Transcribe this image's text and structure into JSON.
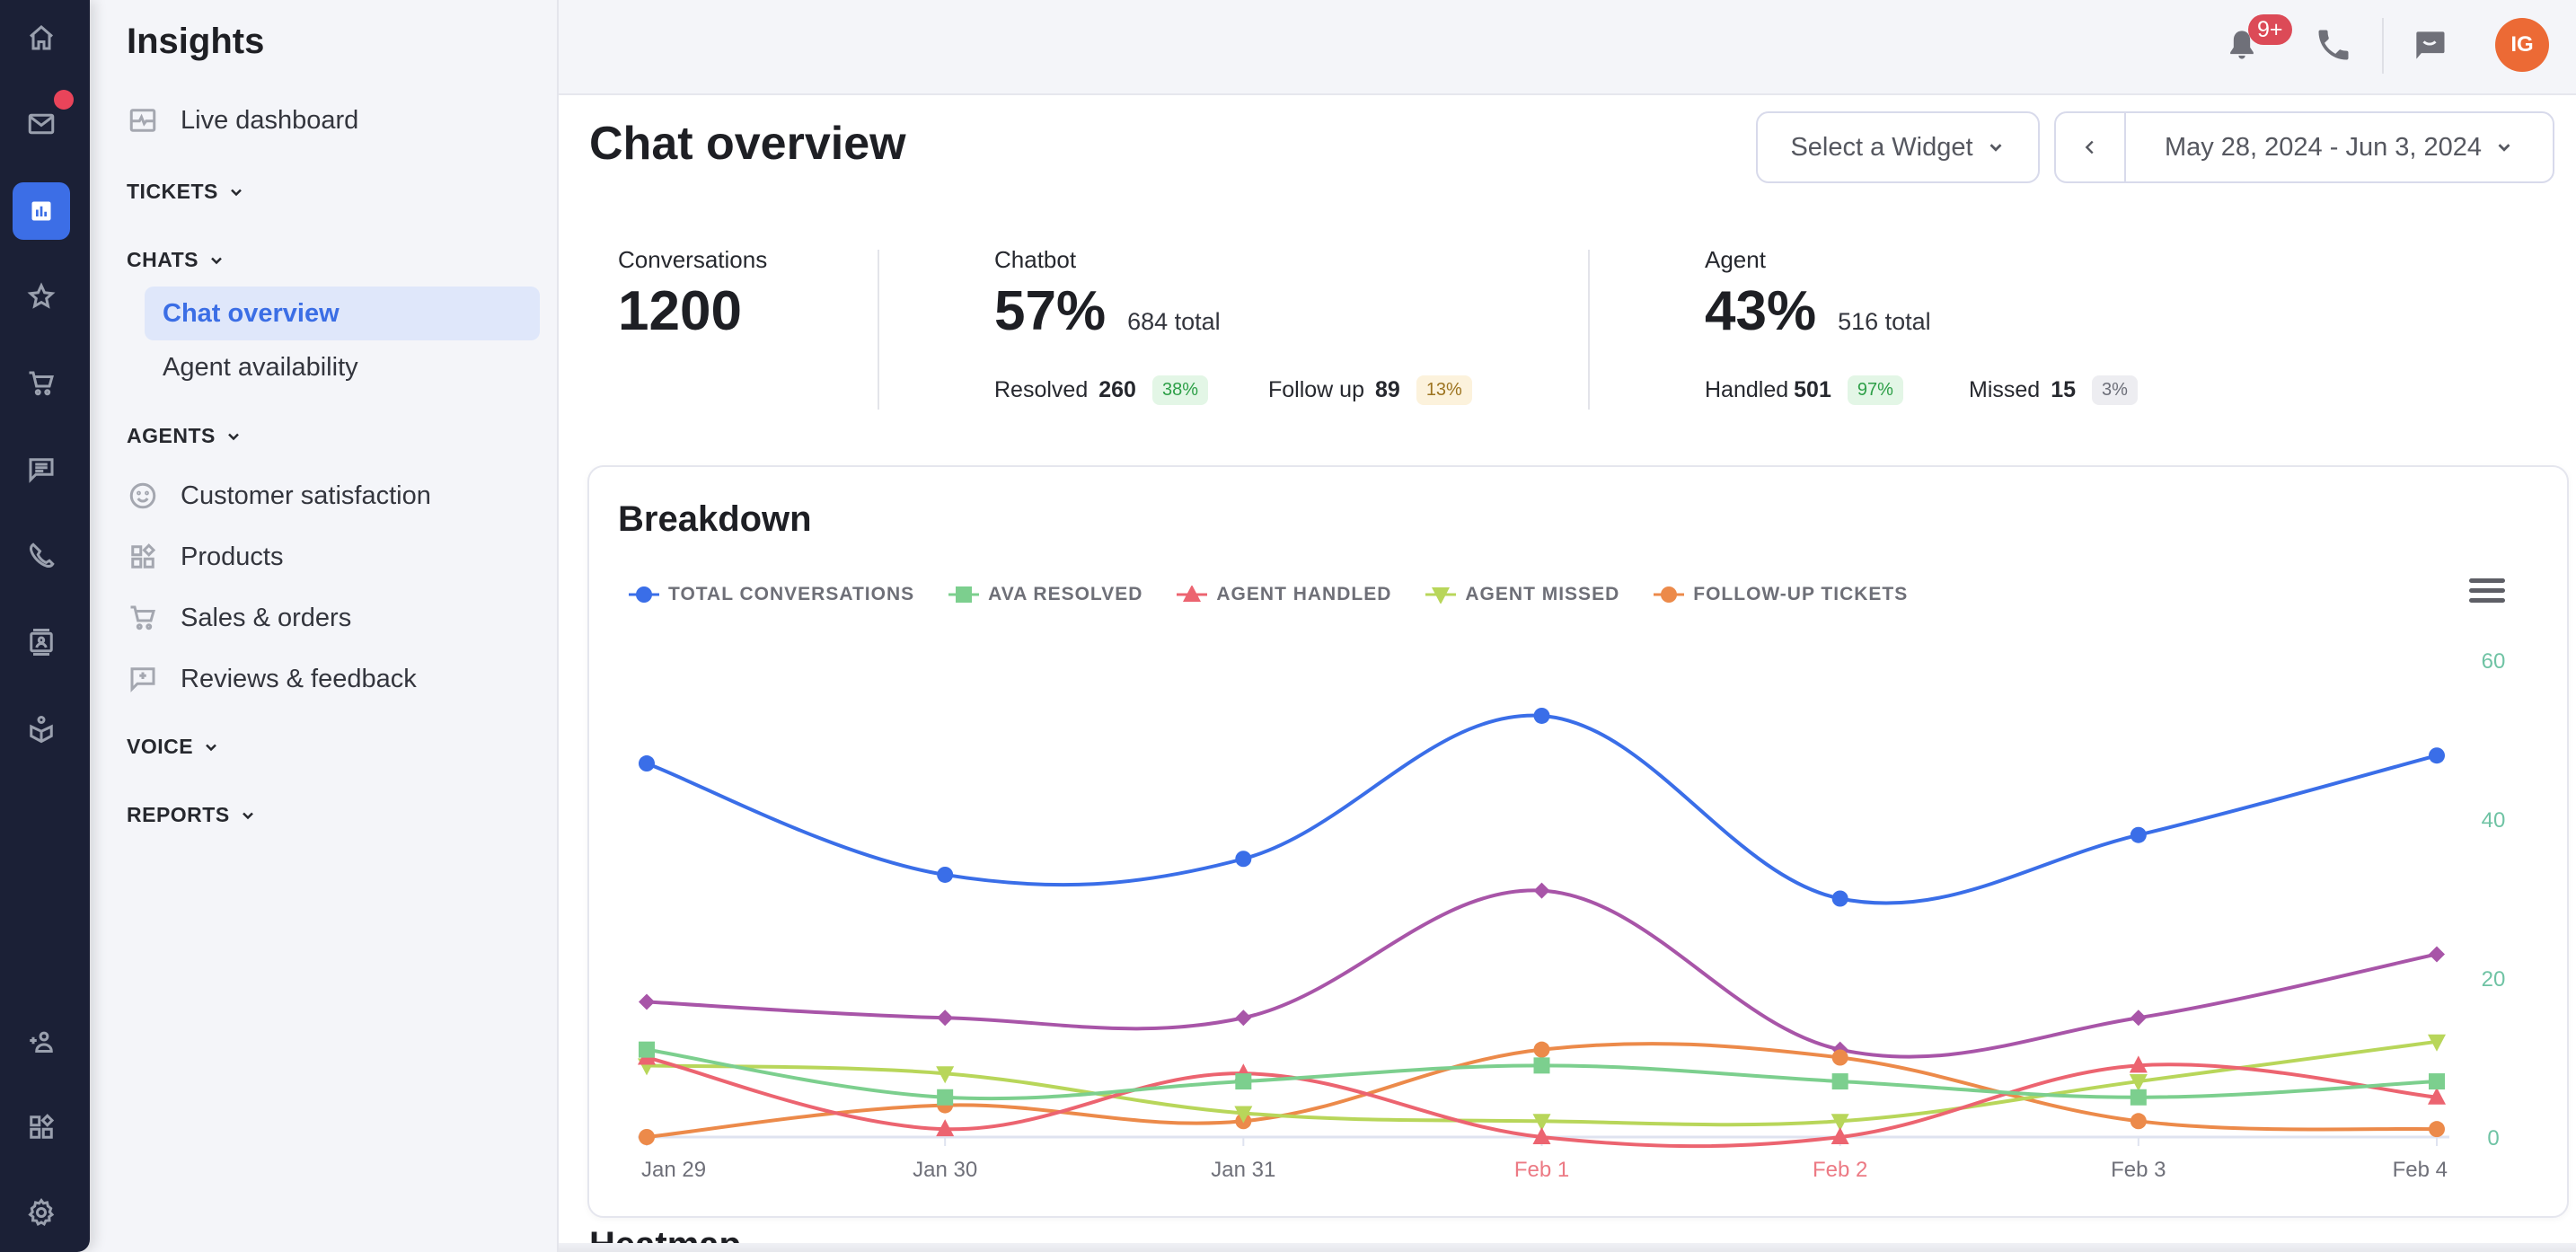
{
  "rail": {
    "items": [
      {
        "name": "home-icon",
        "active": false
      },
      {
        "name": "mail-icon",
        "active": false,
        "has_notification": true
      },
      {
        "name": "insights-icon",
        "active": true
      },
      {
        "name": "star-icon",
        "active": false
      },
      {
        "name": "cart-icon",
        "active": false
      },
      {
        "name": "chat-icon",
        "active": false
      },
      {
        "name": "phone-icon",
        "active": false
      },
      {
        "name": "contacts-icon",
        "active": false
      },
      {
        "name": "knowledge-icon",
        "active": false
      },
      {
        "name": "add-user-icon",
        "active": false
      },
      {
        "name": "apps-icon",
        "active": false
      },
      {
        "name": "gear-icon",
        "active": false
      }
    ]
  },
  "sidebar": {
    "title": "Insights",
    "live_dashboard": "Live dashboard",
    "sections": {
      "tickets": "TICKETS",
      "chats": "CHATS",
      "agents": "AGENTS",
      "voice": "VOICE",
      "reports": "REPORTS"
    },
    "chats_items": [
      "Chat overview",
      "Agent availability"
    ],
    "agents_items": [
      "Customer satisfaction",
      "Products",
      "Sales & orders",
      "Reviews & feedback"
    ],
    "active_item": "Chat overview"
  },
  "topbar": {
    "notification_badge": "9+",
    "avatar_initials": "IG"
  },
  "header": {
    "title": "Chat overview",
    "widget_select": "Select a Widget",
    "date_range": "May 28, 2024 - Jun 3, 2024"
  },
  "stats": {
    "conversations": {
      "label": "Conversations",
      "value": "1200"
    },
    "chatbot": {
      "label": "Chatbot",
      "percent": "57%",
      "total": "684 total",
      "resolved_label": "Resolved",
      "resolved_value": "260",
      "resolved_pct": "38%",
      "followup_label": "Follow up",
      "followup_value": "89",
      "followup_pct": "13%"
    },
    "agent": {
      "label": "Agent",
      "percent": "43%",
      "total": "516 total",
      "handled_label": "Handled",
      "handled_value": "501",
      "handled_pct": "97%",
      "missed_label": "Missed",
      "missed_value": "15",
      "missed_pct": "3%"
    }
  },
  "breakdown": {
    "title": "Breakdown",
    "next_section_title": "Heatmap"
  },
  "chart_data": {
    "type": "line",
    "title": "Breakdown",
    "categories": [
      "Jan 29",
      "Jan 30",
      "Jan 31",
      "Feb 1",
      "Feb 2",
      "Feb 3",
      "Feb 4"
    ],
    "highlighted_categories": [
      "Feb 1",
      "Feb 2"
    ],
    "yaxis_position": "right",
    "yticks": [
      0,
      20,
      40,
      60
    ],
    "ylim": [
      0,
      60
    ],
    "legend_position": "top-left",
    "smooth": true,
    "series": [
      {
        "name": "TOTAL CONVERSATIONS",
        "color": "#3a6ee8",
        "marker": "circle",
        "values": [
          47,
          33,
          35,
          53,
          30,
          38,
          48
        ],
        "in_legend": true
      },
      {
        "name": "AVA RESOLVED",
        "color": "#7ccf8e",
        "marker": "square",
        "values": [
          11,
          5,
          7,
          9,
          7,
          5,
          7
        ],
        "in_legend": true
      },
      {
        "name": "AGENT HANDLED",
        "color": "#ec6470",
        "marker": "triangle",
        "values": [
          10,
          1,
          8,
          0,
          0,
          9,
          5
        ],
        "in_legend": true
      },
      {
        "name": "AGENT MISSED",
        "color": "#b8d65a",
        "marker": "triangle-down",
        "values": [
          9,
          8,
          3,
          2,
          2,
          7,
          12
        ],
        "in_legend": true
      },
      {
        "name": "FOLLOW-UP TICKETS",
        "color": "#ec8a4a",
        "marker": "circle",
        "values": [
          0,
          4,
          2,
          11,
          10,
          2,
          1
        ],
        "in_legend": true
      },
      {
        "name": "",
        "color": "#a855a8",
        "marker": "diamond",
        "values": [
          17,
          15,
          15,
          31,
          11,
          15,
          23
        ],
        "in_legend": false
      }
    ],
    "colors": {
      "axis_tick": "#6fc3a4",
      "x_label": "#6f7079",
      "x_label_highlight": "#ec7a84"
    }
  }
}
